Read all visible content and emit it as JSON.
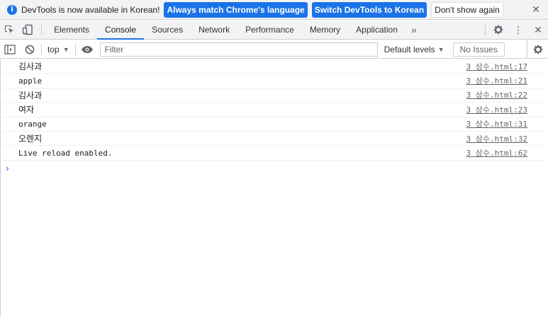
{
  "infobar": {
    "icon": "info-icon",
    "message": "DevTools is now available in Korean!",
    "match_label": "Always match Chrome's language",
    "switch_label": "Switch DevTools to Korean",
    "dismiss_label": "Don't show again",
    "close_glyph": "✕"
  },
  "tabbar": {
    "tabs": [
      {
        "label": "Elements"
      },
      {
        "label": "Console"
      },
      {
        "label": "Sources"
      },
      {
        "label": "Network"
      },
      {
        "label": "Performance"
      },
      {
        "label": "Memory"
      },
      {
        "label": "Application"
      }
    ],
    "active_tab": "Console",
    "more_glyph": "»",
    "settings_icon": "gear-icon",
    "menu_glyph": "⋮",
    "close_glyph": "✕"
  },
  "console_toolbar": {
    "context": "top",
    "filter_placeholder": "Filter",
    "levels_label": "Default levels",
    "issues_label": "No Issues"
  },
  "messages": [
    {
      "text": "김사과",
      "source": "3 상수.html:17",
      "korean": true
    },
    {
      "text": "apple",
      "source": "3 상수.html:21",
      "korean": false
    },
    {
      "text": "김사과",
      "source": "3 상수.html:22",
      "korean": true
    },
    {
      "text": "여자",
      "source": "3 상수.html:23",
      "korean": true
    },
    {
      "text": "orange",
      "source": "3 상수.html:31",
      "korean": false
    },
    {
      "text": "오렌지",
      "source": "3 상수.html:32",
      "korean": true
    },
    {
      "text": "Live reload enabled.",
      "source": "3 상수.html:62",
      "korean": false
    }
  ],
  "prompt_glyph": "›",
  "colors": {
    "accent": "#1a73e8",
    "toolbar_bg": "#f1f3f4",
    "border": "#cbcdd1"
  }
}
